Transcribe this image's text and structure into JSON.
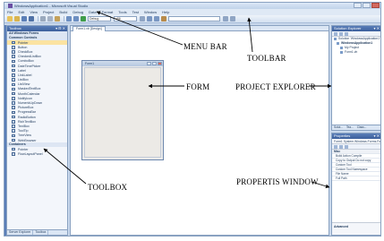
{
  "window": {
    "title": "WindowsApplication1 - Microsoft Visual Studio"
  },
  "menu": [
    "File",
    "Edit",
    "View",
    "Project",
    "Build",
    "Debug",
    "Data",
    "Format",
    "Tools",
    "Test",
    "Window",
    "Help"
  ],
  "toolbar": {
    "config_value": "Debug",
    "platform_value": "x86"
  },
  "toolbox": {
    "title": "Toolbox",
    "group_all": "All Windows Forms",
    "group_common": "Common Controls",
    "items": [
      "Pointer",
      "Button",
      "CheckBox",
      "CheckedListBox",
      "ComboBox",
      "DateTimePicker",
      "Label",
      "LinkLabel",
      "ListBox",
      "ListView",
      "MaskedTextBox",
      "MonthCalendar",
      "NotifyIcon",
      "NumericUpDown",
      "PictureBox",
      "ProgressBar",
      "RadioButton",
      "RichTextBox",
      "TextBox",
      "ToolTip",
      "TreeView",
      "WebBrowser"
    ],
    "group_containers": "Containers",
    "container_items": [
      "Pointer",
      "FlowLayoutPanel"
    ],
    "bottom_tabs": [
      "Server Explorer",
      "Toolbox"
    ]
  },
  "document": {
    "tab": "Form1.vb [Design]",
    "form_title": "Form1"
  },
  "solution_explorer": {
    "title": "Solution Explorer",
    "rows": [
      "Solution 'WindowsApplication1'",
      "WindowsApplication1",
      "My Project",
      "Form1.vb"
    ],
    "tabs": [
      "Solut...",
      "Tea...",
      "Class..."
    ]
  },
  "properties": {
    "title": "Properties",
    "object": "Form1 System.Windows.Forms.Form",
    "rows": [
      {
        "text": "Misc",
        "cat": true
      },
      {
        "text": "Build Action   Compile",
        "cat": false
      },
      {
        "text": "Copy to Output  Do not copy",
        "cat": false
      },
      {
        "text": "Custom Tool",
        "cat": false
      },
      {
        "text": "Custom Tool Namespace",
        "cat": false
      },
      {
        "text": "File Name",
        "cat": false
      },
      {
        "text": "Full Path",
        "cat": false
      }
    ],
    "desc": "Advanced"
  },
  "annotations": {
    "menu_bar": "MENU BAR",
    "toolbar": "TOOLBAR",
    "form": "FORM",
    "project_explorer": "PROJECT EXPLORER",
    "toolbox": "TOOLBOX",
    "properties_window": "PROPERTIS WINDOW"
  }
}
